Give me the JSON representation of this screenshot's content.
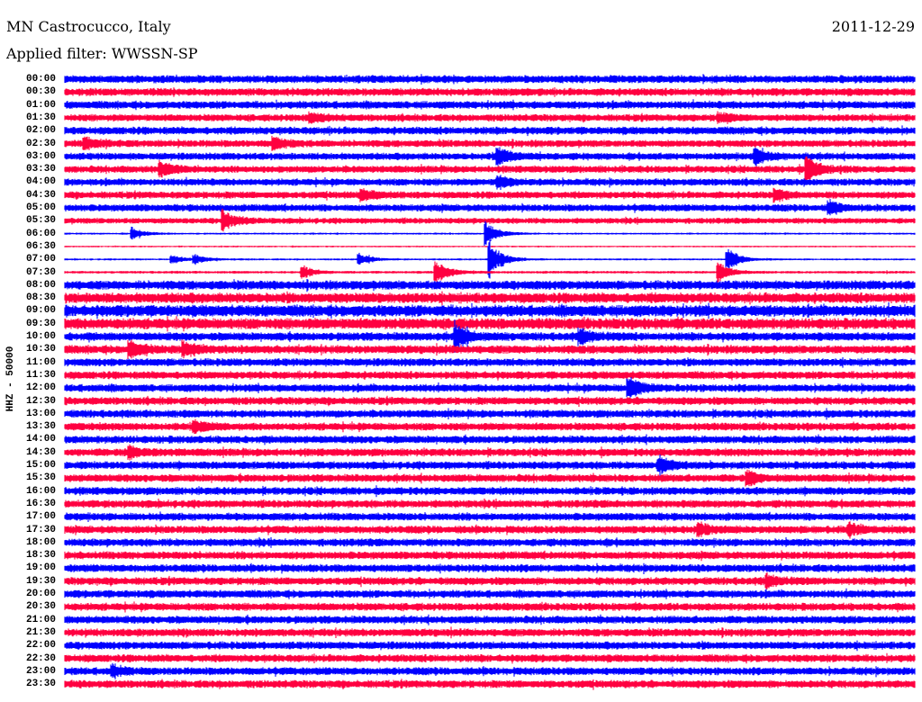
{
  "header": {
    "station": "MN Castrocucco, Italy",
    "filter": "Applied filter: WWSSN-SP",
    "date": "2011-12-29"
  },
  "chart_data": {
    "type": "line",
    "subtype": "helicorder",
    "title": "MN Castrocucco, Italy",
    "ylabel": "HHZ - 50000",
    "minutes_per_row": 30,
    "colors": [
      "#0000ff",
      "#ff0040"
    ],
    "row_labels": [
      "00:00",
      "00:30",
      "01:00",
      "01:30",
      "02:00",
      "02:30",
      "03:00",
      "03:30",
      "04:00",
      "04:30",
      "05:00",
      "05:30",
      "06:00",
      "06:30",
      "07:00",
      "07:30",
      "08:00",
      "08:30",
      "09:00",
      "09:30",
      "10:00",
      "10:30",
      "11:00",
      "11:30",
      "12:00",
      "12:30",
      "13:00",
      "13:30",
      "14:00",
      "14:30",
      "15:00",
      "15:30",
      "16:00",
      "16:30",
      "17:00",
      "17:30",
      "18:00",
      "18:30",
      "19:00",
      "19:30",
      "20:00",
      "20:30",
      "21:00",
      "21:30",
      "22:00",
      "22:30",
      "23:00",
      "23:30"
    ],
    "noise_level": [
      0.6,
      0.6,
      0.6,
      0.55,
      0.6,
      0.55,
      0.55,
      0.55,
      0.55,
      0.55,
      0.55,
      0.45,
      0.15,
      0.12,
      0.15,
      0.2,
      0.7,
      0.8,
      0.9,
      0.85,
      0.65,
      0.65,
      0.6,
      0.6,
      0.6,
      0.6,
      0.6,
      0.6,
      0.6,
      0.6,
      0.6,
      0.6,
      0.6,
      0.6,
      0.6,
      0.6,
      0.6,
      0.6,
      0.6,
      0.6,
      0.6,
      0.6,
      0.6,
      0.6,
      0.6,
      0.6,
      0.6,
      0.6
    ],
    "events": [
      {
        "row": 3,
        "minute": 8.7,
        "amp": 0.5
      },
      {
        "row": 3,
        "minute": 23.1,
        "amp": 0.5
      },
      {
        "row": 5,
        "minute": 0.7,
        "amp": 0.7
      },
      {
        "row": 5,
        "minute": 7.4,
        "amp": 0.7
      },
      {
        "row": 6,
        "minute": 15.3,
        "amp": 1.0
      },
      {
        "row": 6,
        "minute": 24.4,
        "amp": 0.9
      },
      {
        "row": 7,
        "minute": 3.4,
        "amp": 0.8
      },
      {
        "row": 7,
        "minute": 26.2,
        "amp": 1.4
      },
      {
        "row": 8,
        "minute": 15.3,
        "amp": 0.6
      },
      {
        "row": 9,
        "minute": 10.5,
        "amp": 0.6
      },
      {
        "row": 9,
        "minute": 25.1,
        "amp": 0.6
      },
      {
        "row": 10,
        "minute": 27.0,
        "amp": 0.7
      },
      {
        "row": 11,
        "minute": 5.6,
        "amp": 1.2
      },
      {
        "row": 12,
        "minute": 2.4,
        "amp": 0.7
      },
      {
        "row": 12,
        "minute": 14.9,
        "amp": 1.5
      },
      {
        "row": 14,
        "minute": 3.8,
        "amp": 0.5
      },
      {
        "row": 14,
        "minute": 4.6,
        "amp": 0.5
      },
      {
        "row": 14,
        "minute": 10.4,
        "amp": 0.7
      },
      {
        "row": 14,
        "minute": 15.0,
        "amp": 2.5
      },
      {
        "row": 14,
        "minute": 23.4,
        "amp": 1.5
      },
      {
        "row": 15,
        "minute": 8.4,
        "amp": 0.8
      },
      {
        "row": 15,
        "minute": 13.1,
        "amp": 1.5
      },
      {
        "row": 15,
        "minute": 23.1,
        "amp": 1.2
      },
      {
        "row": 20,
        "minute": 13.8,
        "amp": 1.5
      },
      {
        "row": 20,
        "minute": 18.2,
        "amp": 0.7
      },
      {
        "row": 21,
        "minute": 2.3,
        "amp": 0.8
      },
      {
        "row": 21,
        "minute": 4.2,
        "amp": 0.8
      },
      {
        "row": 24,
        "minute": 19.9,
        "amp": 1.2
      },
      {
        "row": 27,
        "minute": 4.6,
        "amp": 0.6
      },
      {
        "row": 29,
        "minute": 2.3,
        "amp": 0.6
      },
      {
        "row": 30,
        "minute": 21.0,
        "amp": 0.8
      },
      {
        "row": 31,
        "minute": 24.1,
        "amp": 0.8
      },
      {
        "row": 35,
        "minute": 22.4,
        "amp": 0.6
      },
      {
        "row": 35,
        "minute": 27.7,
        "amp": 0.6
      },
      {
        "row": 39,
        "minute": 24.8,
        "amp": 0.6
      },
      {
        "row": 46,
        "minute": 1.7,
        "amp": 0.5
      }
    ]
  }
}
